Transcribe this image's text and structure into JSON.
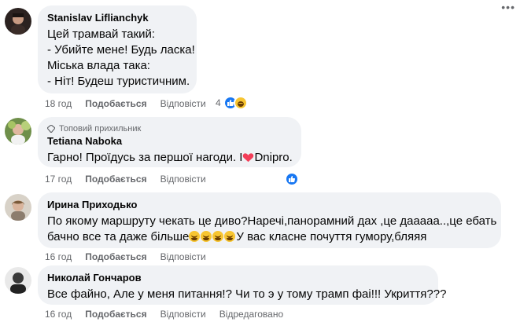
{
  "comments": [
    {
      "author": "Stanislav Liflianchyk",
      "lines": [
        "Цей трамвай такий:",
        "- Убийте мене! Будь ласка!",
        "Міська влада така:",
        "- Ніт! Будеш туристичним."
      ],
      "time": "18 год",
      "like_label": "Подобається",
      "reply_label": "Відповісти",
      "reaction_count": "4",
      "reaction_icons": [
        "like-icon",
        "haha-icon"
      ]
    },
    {
      "author": "Tetiana Naboka",
      "badge": "Топовий прихильник",
      "lines_prefix": "Гарно! Проїдусь за першої нагоди. I",
      "lines_suffix": "Dnipro.",
      "time": "17 год",
      "like_label": "Подобається",
      "reply_label": "Відповісти",
      "reaction_icons": [
        "like-icon"
      ]
    },
    {
      "author": "Ирина Приходько",
      "line1": "По якому маршруту чекать це диво?Наречі,панорамний дах ,це дааааа..,це ебать",
      "line2_prefix": "бачно все та даже більше",
      "line2_suffix": "У вас класне почуття гумору,бляяя",
      "time": "16 год",
      "like_label": "Подобається",
      "reply_label": "Відповісти"
    },
    {
      "author": "Николай Гончаров",
      "line1": "Все файно, Але у меня питання!? Чи то э у тому трамп фаі!!! Укриття???",
      "time": "16 год",
      "like_label": "Подобається",
      "reply_label": "Відповісти",
      "edited_label": "Відредаговано"
    }
  ],
  "colors": {
    "bubble": "#f0f2f5",
    "secondary_text": "#65676b",
    "like_blue": "#1877f2",
    "heart_red": "#f33e58"
  }
}
